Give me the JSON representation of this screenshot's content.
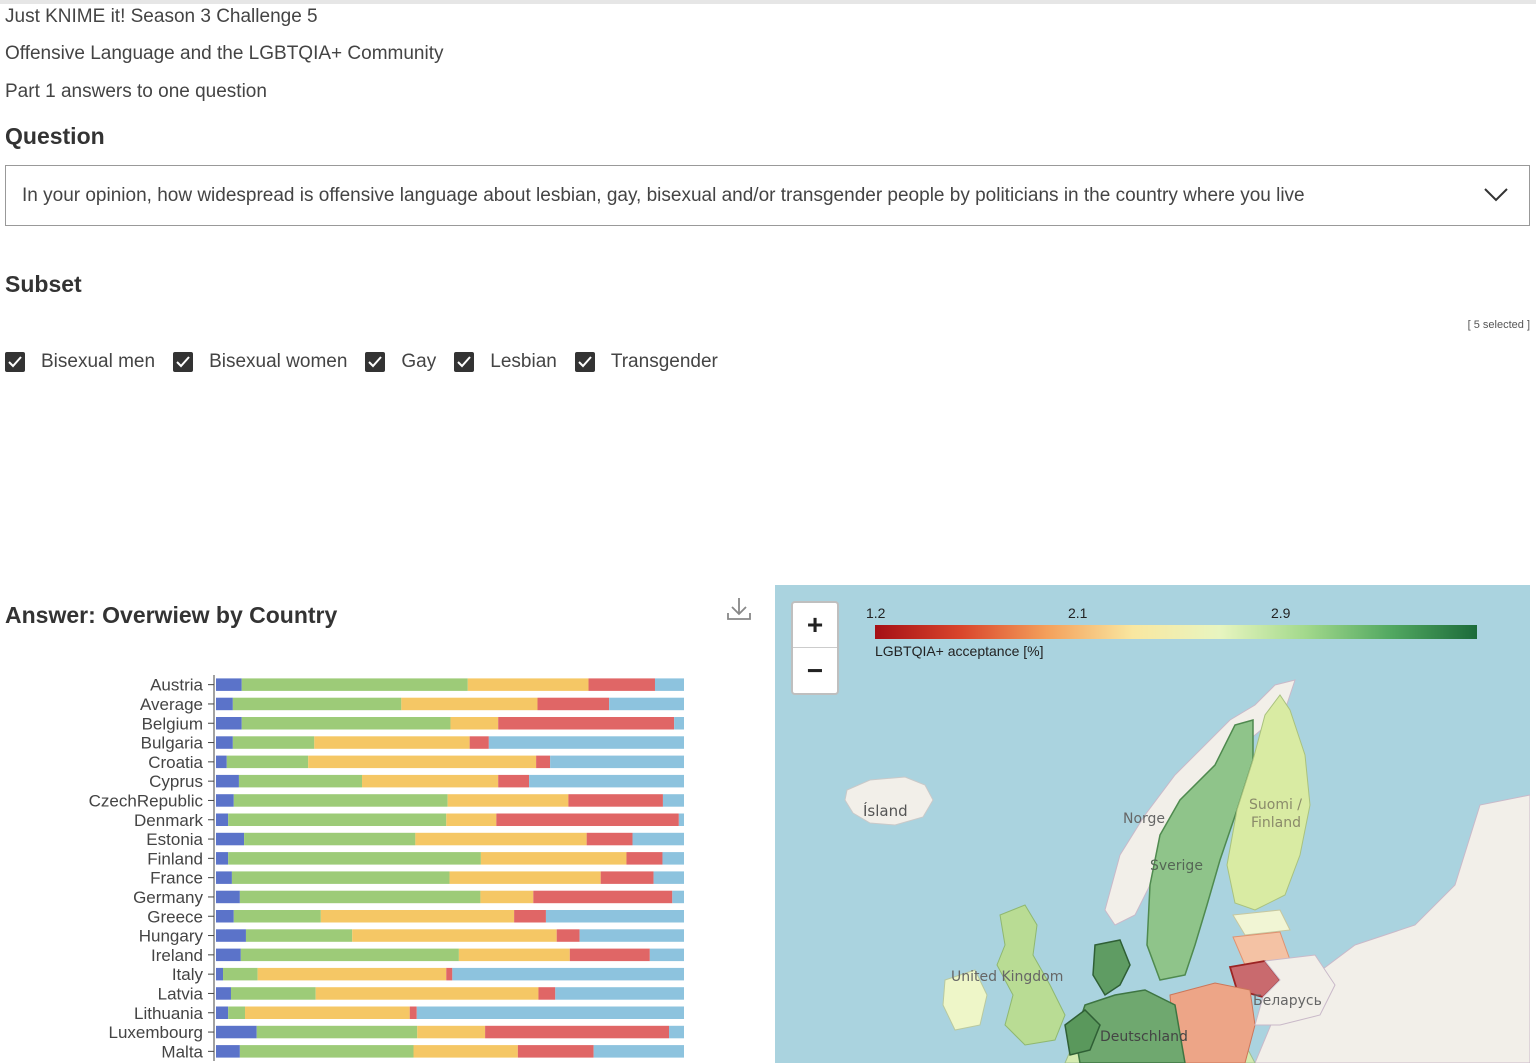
{
  "header": {
    "line1": "Just KNIME it! Season 3 Challenge 5",
    "line2": "Offensive Language and the LGBTQIA+ Community",
    "line3": "Part 1 answers to one question"
  },
  "question": {
    "heading": "Question",
    "selected": "In your opinion, how widespread is offensive language about lesbian, gay, bisexual and/or transgender people by politicians in the country where you live"
  },
  "subset": {
    "heading": "Subset",
    "selected_count": "[ 5 selected ]",
    "options": [
      {
        "label": "Bisexual men",
        "checked": true
      },
      {
        "label": "Bisexual women",
        "checked": true
      },
      {
        "label": "Gay",
        "checked": true
      },
      {
        "label": "Lesbian",
        "checked": true
      },
      {
        "label": "Transgender",
        "checked": true
      }
    ]
  },
  "answer": {
    "heading": "Answer: Overwiew by Country",
    "download_icon": "download-icon"
  },
  "colors": {
    "segments": [
      "#5b73c9",
      "#9dcb78",
      "#f5c765",
      "#e06666",
      "#8dc3de"
    ]
  },
  "chart_data": {
    "type": "bar",
    "orientation": "horizontal",
    "stacked": true,
    "categories": [
      "Austria",
      "Average",
      "Belgium",
      "Bulgaria",
      "Croatia",
      "Cyprus",
      "CzechRepublic",
      "Denmark",
      "Estonia",
      "Finland",
      "France",
      "Germany",
      "Greece",
      "Hungary",
      "Ireland",
      "Italy",
      "Latvia",
      "Lithuania",
      "Luxembourg",
      "Malta"
    ],
    "xlim": [
      0,
      100
    ],
    "series": [
      {
        "values": [
          5.5,
          3.6,
          5.5,
          3.6,
          2.3,
          4.9,
          3.8,
          2.6,
          6.0,
          2.6,
          3.4,
          5.1,
          3.8,
          6.4,
          5.3,
          1.5,
          3.2,
          2.6,
          8.7,
          5.1
        ]
      },
      {
        "values": [
          48.3,
          36.0,
          44.6,
          17.4,
          17.4,
          26.3,
          45.7,
          46.6,
          36.6,
          54.0,
          46.5,
          51.4,
          18.6,
          22.7,
          46.6,
          7.4,
          18.1,
          3.6,
          34.3,
          37.1
        ]
      },
      {
        "values": [
          25.8,
          29.1,
          10.2,
          33.2,
          48.7,
          29.1,
          25.8,
          10.7,
          36.6,
          31.1,
          32.3,
          11.3,
          41.3,
          43.7,
          23.7,
          40.3,
          47.6,
          35.2,
          14.5,
          22.3
        ]
      },
      {
        "values": [
          14.2,
          15.3,
          37.6,
          4.1,
          3.0,
          6.6,
          20.2,
          39.0,
          9.8,
          7.7,
          11.3,
          29.7,
          6.8,
          4.9,
          17.1,
          1.3,
          3.6,
          1.5,
          39.3,
          16.2
        ]
      },
      {
        "values": [
          6.2,
          16.0,
          2.1,
          41.7,
          28.6,
          33.1,
          4.5,
          1.1,
          11.0,
          4.6,
          6.5,
          2.5,
          29.5,
          22.3,
          7.3,
          49.5,
          27.5,
          57.1,
          3.2,
          19.3
        ]
      }
    ]
  },
  "map": {
    "legend_title": "LGBTQIA+ acceptance [%]",
    "legend_ticks": [
      "1.2",
      "2.1",
      "2.9"
    ],
    "zoom_in": "+",
    "zoom_out": "−",
    "labels": {
      "iceland": "Ísland",
      "norway": "Norge",
      "finland_fi": "Suomi /",
      "finland_en": "Finland",
      "sweden": "Sverige",
      "uk": "United Kingdom",
      "belarus": "Беларусь",
      "germany": "Deutschland"
    }
  }
}
